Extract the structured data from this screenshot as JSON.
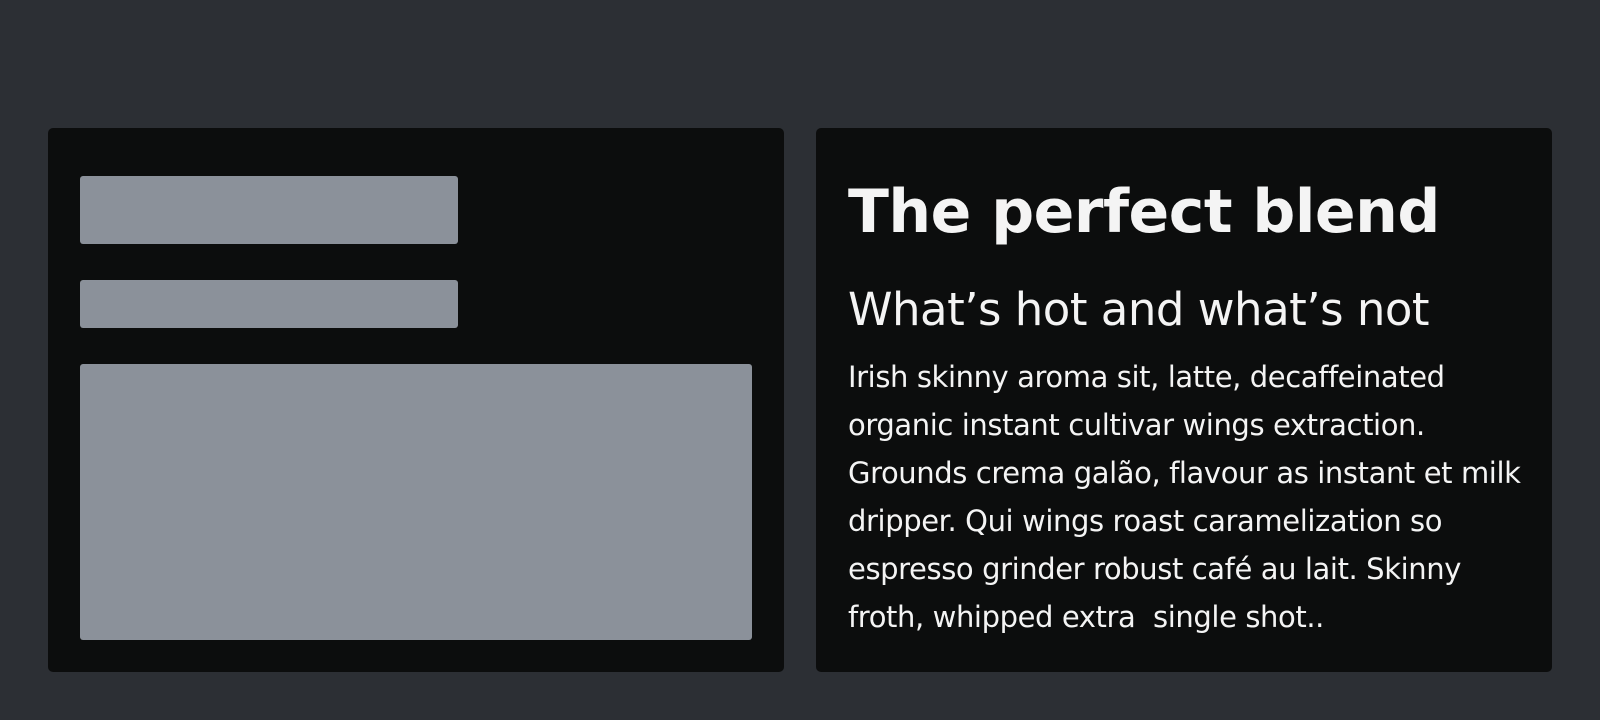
{
  "article": {
    "headline": "The perfect blend",
    "subheading": "What’s hot and what’s not",
    "body": "Irish skinny aroma sit, latte, decaffeinated organic instant cultivar wings extraction. Grounds crema galão, flavour as instant et milk dripper. Qui wings roast caramelization so espresso grinder robust café au lait. Skinny froth, whipped extra  single shot.."
  },
  "colors": {
    "background": "#2c2f34",
    "panel": "#0c0d0d",
    "skeleton": "#8b919a",
    "text": "#f4f4f4"
  }
}
